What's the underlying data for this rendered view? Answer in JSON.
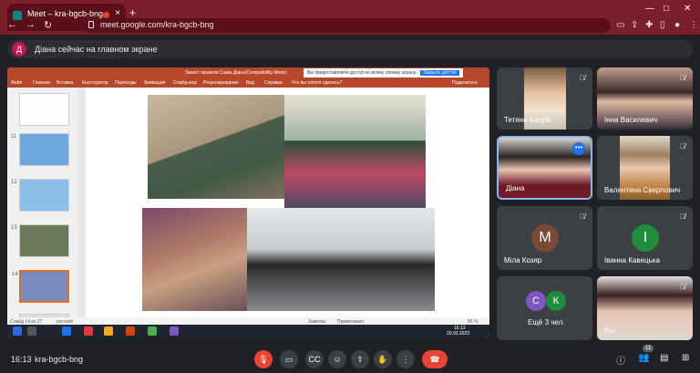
{
  "browser": {
    "tab_title": "Meet – kra-bgcb-bng",
    "new_tab": "+",
    "url": "meet.google.com/kra-bgcb-bng"
  },
  "banner": {
    "avatar_letter": "Д",
    "text": "Діана сейчас на главном экране"
  },
  "ppt": {
    "title": "Захист проектів Сніжа Діана(Compatibility Mode)",
    "share_text": "Вы предоставляете доступ ко всему своему экрану.",
    "share_button": "Закрыть доступ",
    "menu": [
      "Файл",
      "Главная",
      "Вставка",
      "Конструктор",
      "Переходы",
      "Анимация",
      "Слайд-шоу",
      "Рецензирование",
      "Вид",
      "Справка",
      "Что вы хотите сделать?",
      "Поделиться"
    ],
    "thumb_numbers": [
      "11",
      "12",
      "13",
      "14"
    ],
    "slide_counter": "Слайд 14 из 27",
    "language": "русский",
    "notes_label": "Заметки",
    "comments_label": "Примечания",
    "zoom": "85 %",
    "clock_time": "16:13",
    "clock_date": "20.03.2023"
  },
  "participants": [
    {
      "name": "Тетяна Багрій",
      "muted": true
    },
    {
      "name": "Інна Василевич",
      "muted": true
    },
    {
      "name": "Діана",
      "muted": false
    },
    {
      "name": "Валентина Сверлович",
      "muted": true
    },
    {
      "name": "Міла Козяр",
      "initial": "М",
      "color": "#7b4a36",
      "muted": true
    },
    {
      "name": "Іванна Кавецька",
      "initial": "І",
      "color": "#1e8e3e",
      "muted": true
    },
    {
      "name": "Ещё 3 чел.",
      "initials": [
        "С",
        "К"
      ],
      "colors": [
        "#7e57c2",
        "#1e8e3e"
      ]
    },
    {
      "name": "Вы",
      "muted": true
    }
  ],
  "controls": {
    "time": "16:13",
    "meeting_code": "kra-bgcb-bng",
    "participant_count": "11"
  }
}
